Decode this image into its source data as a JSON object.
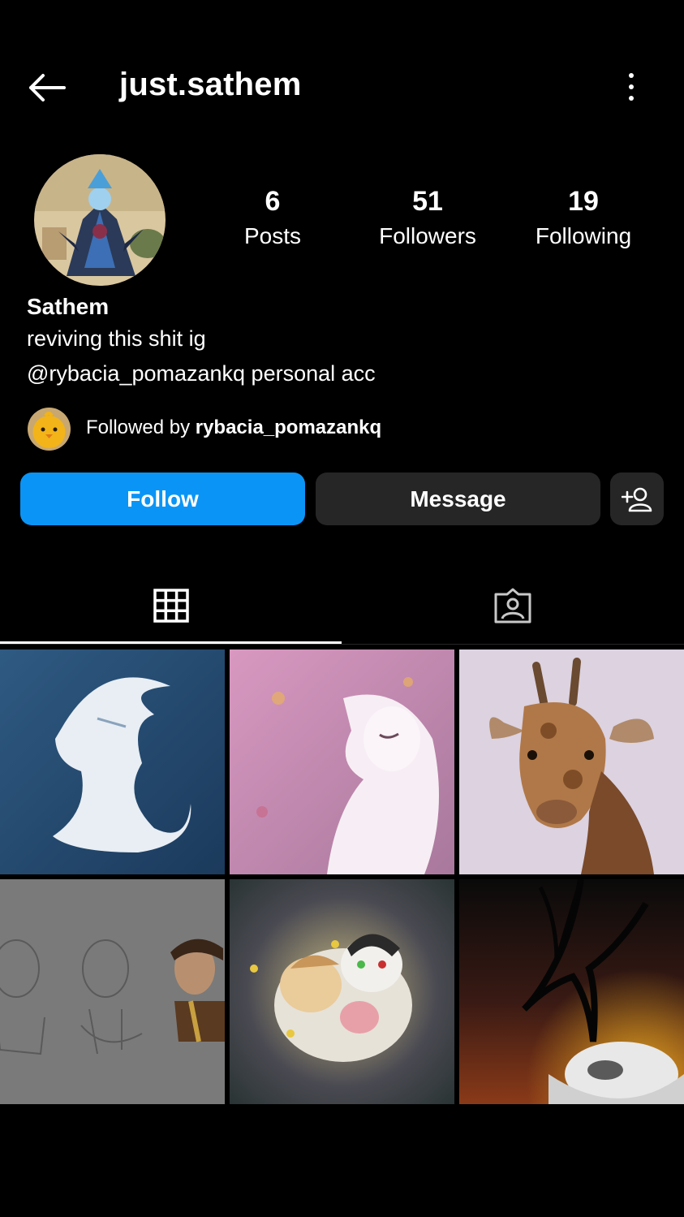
{
  "header": {
    "username": "just.sathem",
    "back_icon": "arrow-left-icon",
    "menu_icon": "more-vertical-icon"
  },
  "stats": {
    "posts": {
      "value": "6",
      "label": "Posts"
    },
    "followers": {
      "value": "51",
      "label": "Followers"
    },
    "following": {
      "value": "19",
      "label": "Following"
    }
  },
  "bio": {
    "name": "Sathem",
    "line1": "reviving this shit ig",
    "line2": "@rybacia_pomazankq personal acc"
  },
  "followed_by": {
    "prefix": "Followed by ",
    "username": "rybacia_pomazankq"
  },
  "actions": {
    "follow_label": "Follow",
    "message_label": "Message",
    "add_user_icon": "add-person-icon"
  },
  "tabs": {
    "grid_icon": "grid-icon",
    "tagged_icon": "tagged-person-icon"
  },
  "colors": {
    "follow_button": "#0a95f6",
    "secondary_button": "#262626",
    "background": "#000000"
  },
  "posts": [
    {
      "name": "white-dragon-sketch"
    },
    {
      "name": "pink-pony-drawing"
    },
    {
      "name": "giraffe-watercolor"
    },
    {
      "name": "pencil-portraits"
    },
    {
      "name": "chibi-characters"
    },
    {
      "name": "dark-creature-scene"
    }
  ]
}
